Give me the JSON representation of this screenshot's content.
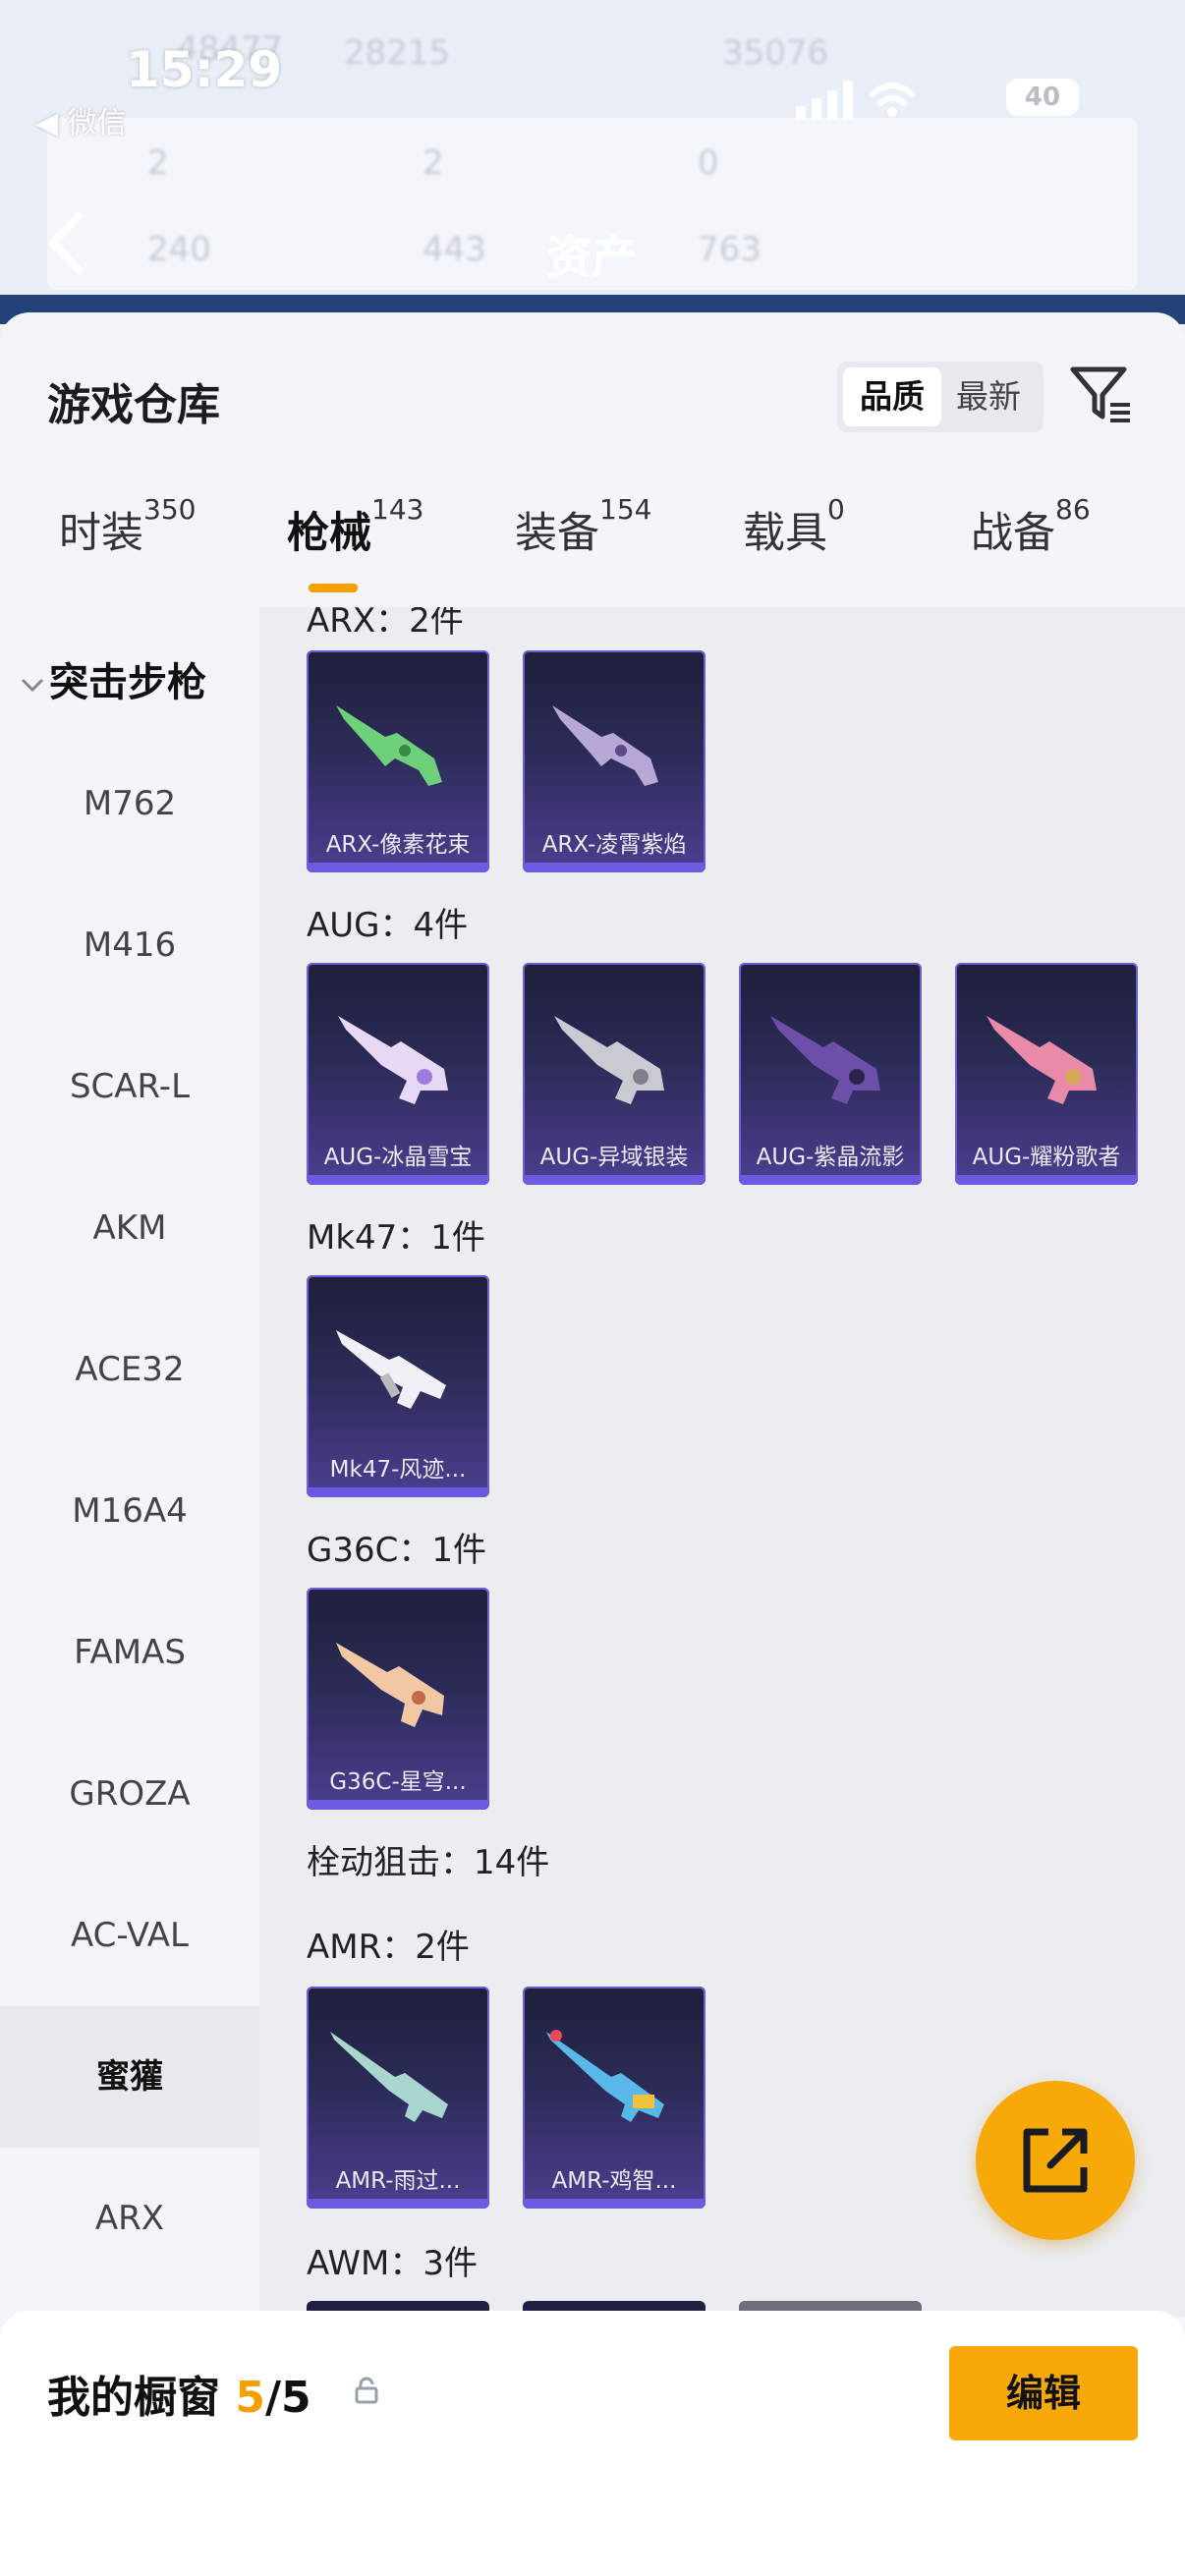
{
  "status_bar": {
    "time": "15:29",
    "back_app": "◀ 微信",
    "battery": "40"
  },
  "background_header": {
    "title": "资产",
    "faint_values": [
      "48477",
      "28215",
      "35076",
      "2",
      "2",
      "0",
      "240",
      "443",
      "763"
    ]
  },
  "sheet": {
    "title": "游戏仓库",
    "sort_options": [
      "品质",
      "最新"
    ],
    "sort_selected": "品质"
  },
  "tabs": [
    {
      "label": "时装",
      "count": "350"
    },
    {
      "label": "枪械",
      "count": "143",
      "active": true
    },
    {
      "label": "装备",
      "count": "154"
    },
    {
      "label": "载具",
      "count": "0"
    },
    {
      "label": "战备",
      "count": "86"
    }
  ],
  "sidebar": {
    "category": "突击步枪",
    "items": [
      "M762",
      "M416",
      "SCAR-L",
      "AKM",
      "ACE32",
      "M16A4",
      "FAMAS",
      "GROZA",
      "AC-VAL",
      "蜜獾",
      "ARX"
    ],
    "active_item": "蜜獾"
  },
  "content": {
    "groups": [
      {
        "title": "ARX：2件",
        "items": [
          "ARX-像素花束",
          "ARX-凌霄紫焰"
        ]
      },
      {
        "title": "AUG：4件",
        "items": [
          "AUG-冰晶雪宝",
          "AUG-异域银装",
          "AUG-紫晶流影",
          "AUG-耀粉歌者"
        ]
      },
      {
        "title": "Mk47：1件",
        "items": [
          "Mk47-风迹..."
        ]
      },
      {
        "title": "G36C：1件",
        "items": [
          "G36C-星穹..."
        ]
      },
      {
        "title": "栓动狙击：14件",
        "items": []
      },
      {
        "title": "AMR：2件",
        "items": [
          "AMR-雨过...",
          "AMR-鸡智..."
        ]
      },
      {
        "title": "AWM：3件",
        "items": []
      }
    ]
  },
  "bottom_bar": {
    "title": "我的橱窗",
    "current": "5",
    "total": "/5",
    "edit_label": "编辑"
  },
  "colors": {
    "accent": "#f7a90a",
    "card_dark": "#1d1f3b",
    "card_purple": "#6a5be0"
  },
  "icons": {
    "filter": "filter-icon",
    "share": "share-external-icon",
    "lock": "lock-icon",
    "chevron": "chevron-down-icon",
    "back": "back-arrow-icon"
  }
}
